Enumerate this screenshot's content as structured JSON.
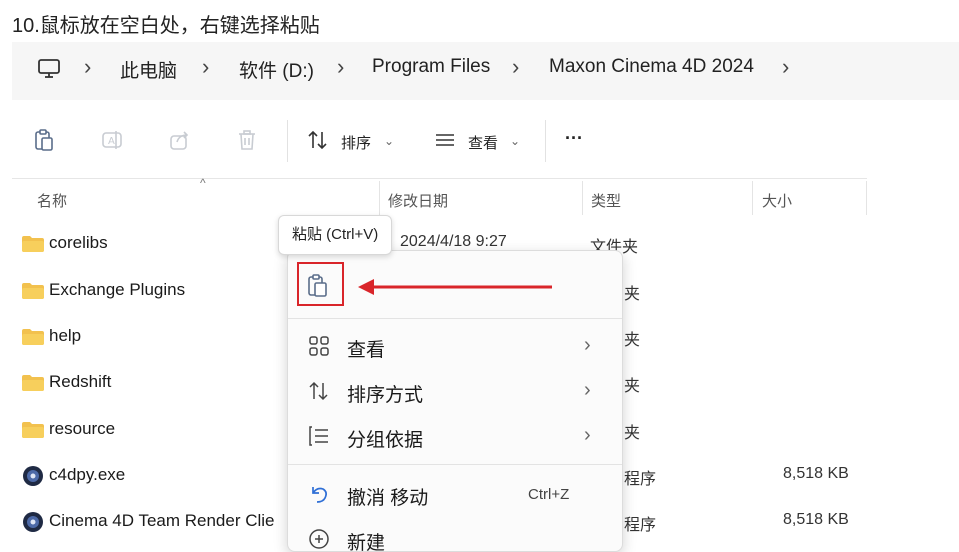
{
  "instruction": "10.鼠标放在空白处，右键选择粘贴",
  "breadcrumb": [
    "此电脑",
    "软件 (D:)",
    "Program Files",
    "Maxon Cinema 4D 2024"
  ],
  "toolbar": {
    "sort_label": "排序",
    "view_label": "查看",
    "more_label": "···"
  },
  "columns": {
    "name": "名称",
    "date": "修改日期",
    "type": "类型",
    "size": "大小"
  },
  "rows": [
    {
      "name": "corelibs",
      "date": "2024/4/18 9:27",
      "type": "文件夹",
      "size": ""
    },
    {
      "name": "Exchange Plugins",
      "date": "",
      "type": "夹",
      "size": ""
    },
    {
      "name": "help",
      "date": "",
      "type": "夹",
      "size": ""
    },
    {
      "name": "Redshift",
      "date": "",
      "type": "夹",
      "size": ""
    },
    {
      "name": "resource",
      "date": "",
      "type": "夹",
      "size": ""
    },
    {
      "name": "c4dpy.exe",
      "date": "",
      "type": "程序",
      "size": "8,518 KB"
    },
    {
      "name": "Cinema 4D Team Render Clie",
      "date": "",
      "type": "程序",
      "size": "8,518 KB"
    }
  ],
  "tooltip": "粘贴 (Ctrl+V)",
  "context_menu": {
    "view": "查看",
    "sort": "排序方式",
    "group": "分组依据",
    "undo": "撤消 移动",
    "undo_shortcut": "Ctrl+Z",
    "new": "新建"
  },
  "colors": {
    "highlight": "#d9252a",
    "folder": "#f2c14e",
    "icon": "#6a6a6a"
  }
}
